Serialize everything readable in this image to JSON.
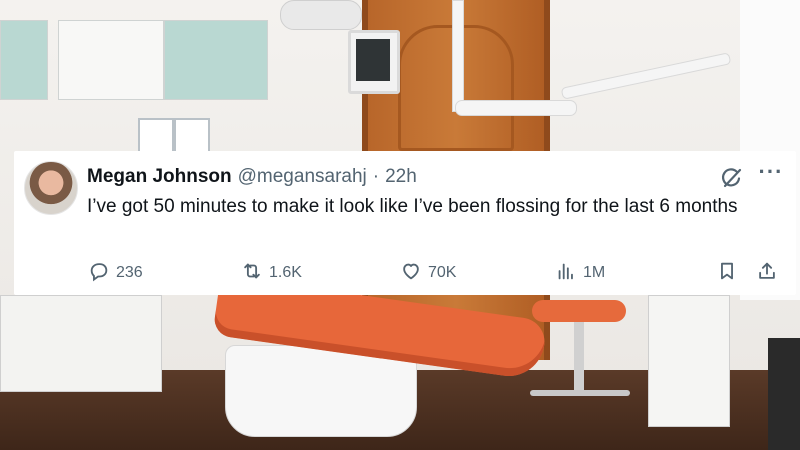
{
  "tweet": {
    "author": {
      "name": "Megan Johnson",
      "handle": "@megansarahj",
      "separator": "·",
      "time": "22h"
    },
    "text": "I’ve got 50 minutes to make it look like I’ve been flossing for the last 6 months",
    "actions": {
      "replies": "236",
      "retweets": "1.6K",
      "likes": "70K",
      "views": "1M"
    },
    "icons": {
      "reply": "reply-icon",
      "retweet": "retweet-icon",
      "like": "heart-icon",
      "views": "analytics-icon",
      "bookmark": "bookmark-icon",
      "share": "share-icon",
      "grok": "grok-icon",
      "more": "more-icon"
    },
    "colors": {
      "text": "#0f1419",
      "muted": "#536471",
      "card": "#ffffff"
    }
  },
  "background": {
    "description_icon": "dental-office-photo"
  }
}
